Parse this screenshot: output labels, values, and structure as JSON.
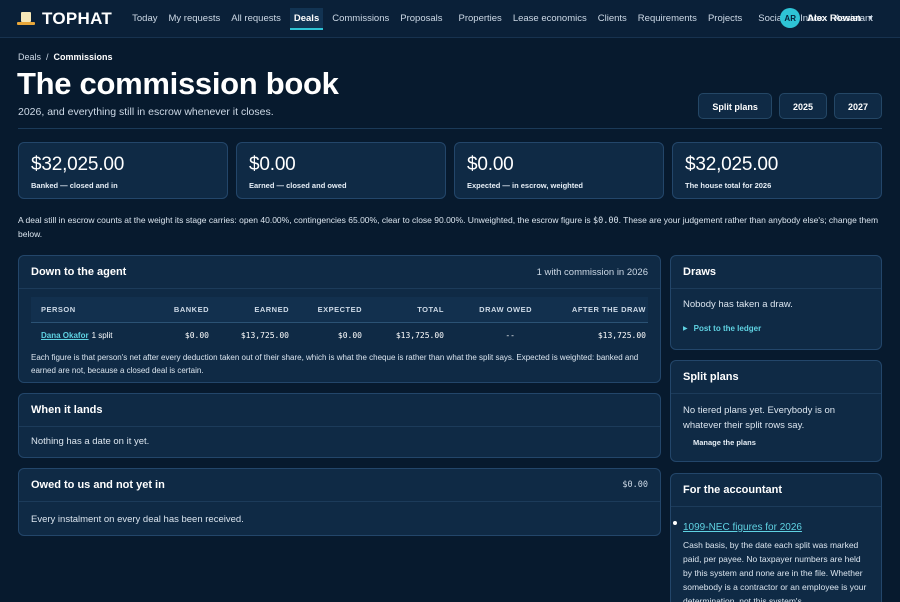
{
  "app": {
    "brand": "TOPHAT",
    "nav": [
      "Today",
      "My requests",
      "All requests",
      "Deals",
      "Commissions",
      "Proposals",
      "Properties",
      "Lease economics",
      "Clients",
      "Requirements",
      "Projects",
      "Social",
      "Inbox",
      "Assistant"
    ],
    "active_nav": "Deals",
    "user": {
      "initials": "AR",
      "name": "Alex Rowan"
    }
  },
  "breadcrumb": {
    "parent": "Deals",
    "separator": "/",
    "current": "Commissions"
  },
  "header": {
    "title": "The commission book",
    "subtitle": "2026, and everything still in escrow whenever it closes.",
    "buttons": [
      "Split plans",
      "2025",
      "2027"
    ]
  },
  "stats": [
    {
      "value": "$32,025.00",
      "label": "Banked — closed and in"
    },
    {
      "value": "$0.00",
      "label": "Earned — closed and owed"
    },
    {
      "value": "$0.00",
      "label": "Expected — in escrow, weighted"
    },
    {
      "value": "$32,025.00",
      "label": "The house total for 2026"
    }
  ],
  "note": {
    "text_before": "A deal still in escrow counts at the weight its stage carries: open 40.00%, contingencies 65.00%, clear to close 90.00%. Unweighted, the escrow figure is ",
    "code": "$0.00",
    "text_after": ". These are your judgement rather than anybody else's; change them below."
  },
  "agent_panel": {
    "title": "Down to the agent",
    "meta": "1 with commission in 2026",
    "columns": [
      "PERSON",
      "BANKED",
      "EARNED",
      "EXPECTED",
      "TOTAL",
      "DRAW OWED",
      "AFTER THE DRAW"
    ],
    "rows": [
      {
        "person": "Dana Okafor",
        "splits": "1 split",
        "banked": "$0.00",
        "earned": "$13,725.00",
        "expected": "$0.00",
        "total": "$13,725.00",
        "draw_owed": "--",
        "after_draw": "$13,725.00"
      }
    ],
    "footnote": "Each figure is that person's net after every deduction taken out of their share, which is what the cheque is rather than what the split says. Expected is weighted: banked and earned are not, because a closed deal is certain."
  },
  "lands_panel": {
    "title": "When it lands",
    "body": "Nothing has a date on it yet."
  },
  "owed_panel": {
    "title": "Owed to us and not yet in",
    "amount": "$0.00",
    "body": "Every instalment on every deal has been received."
  },
  "draws_panel": {
    "title": "Draws",
    "body": "Nobody has taken a draw.",
    "action": "Post to the ledger"
  },
  "splitplans_panel": {
    "title": "Split plans",
    "body": "No tiered plans yet. Everybody is on whatever their split rows say.",
    "action": "Manage the plans"
  },
  "accountant_panel": {
    "title": "For the accountant",
    "link": "1099-NEC figures for 2026",
    "text": "Cash basis, by the date each split was marked paid, per payee. No taxpayer numbers are held by this system and none are in the file. Whether somebody is a contractor or an employee is your determination, not this system's."
  }
}
